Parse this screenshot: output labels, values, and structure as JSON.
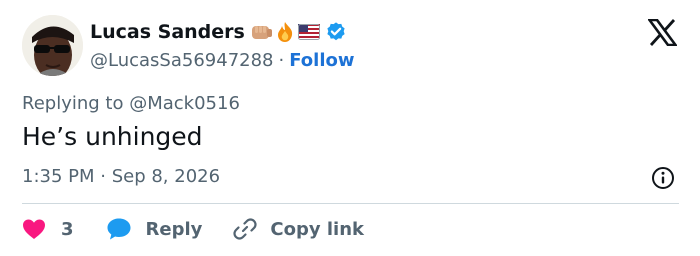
{
  "author": {
    "display_name": "Lucas Sanders",
    "badges": [
      "fist-emoji",
      "fire-emoji",
      "us-flag-emoji",
      "verified-badge"
    ],
    "handle": "@LucasSa56947288",
    "separator": "·",
    "follow_label": "Follow"
  },
  "tweet": {
    "replying_to": "Replying to @Mack0516",
    "text": "He’s unhinged",
    "timestamp": "1:35 PM · Sep 8, 2026"
  },
  "actions": {
    "like_count": "3",
    "reply_label": "Reply",
    "copy_link_label": "Copy link"
  },
  "icons": {
    "brand": "x-logo-icon",
    "info": "info-icon",
    "like": "heart-icon",
    "reply": "speech-bubble-icon",
    "copy": "link-icon"
  },
  "colors": {
    "text_primary": "#0f1419",
    "text_secondary": "#536471",
    "link_blue": "#1d72d6",
    "verified_blue": "#1d9bf0",
    "heart_pink": "#f91880",
    "divider": "#cfd9de"
  }
}
